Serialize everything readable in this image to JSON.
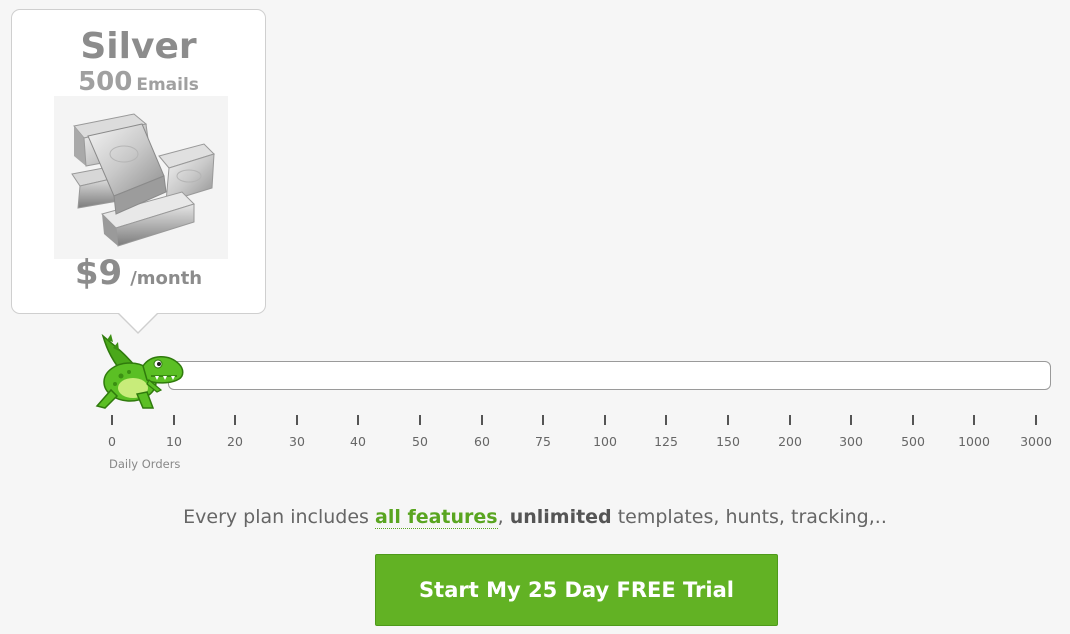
{
  "plan": {
    "name": "Silver",
    "quota_number": "500",
    "quota_unit": "Emails",
    "price": "$9",
    "period": "/month",
    "image_icon": "silver-bars-icon"
  },
  "slider": {
    "handle_icon": "dinosaur-icon",
    "ticks": [
      "0",
      "10",
      "20",
      "30",
      "40",
      "50",
      "60",
      "75",
      "100",
      "125",
      "150",
      "200",
      "300",
      "500",
      "1000",
      "3000"
    ],
    "selected_value": "0",
    "caption": "Daily Orders"
  },
  "features": {
    "prefix": "Every plan includes ",
    "link_text": "all features",
    "comma": ", ",
    "emphasis": "unlimited",
    "suffix": " templates, hunts, tracking,.."
  },
  "cta": {
    "label": "Start My 25 Day FREE Trial"
  },
  "colors": {
    "accent_green": "#62b224",
    "link_green": "#59a520",
    "text_gray": "#8c8c8c"
  }
}
